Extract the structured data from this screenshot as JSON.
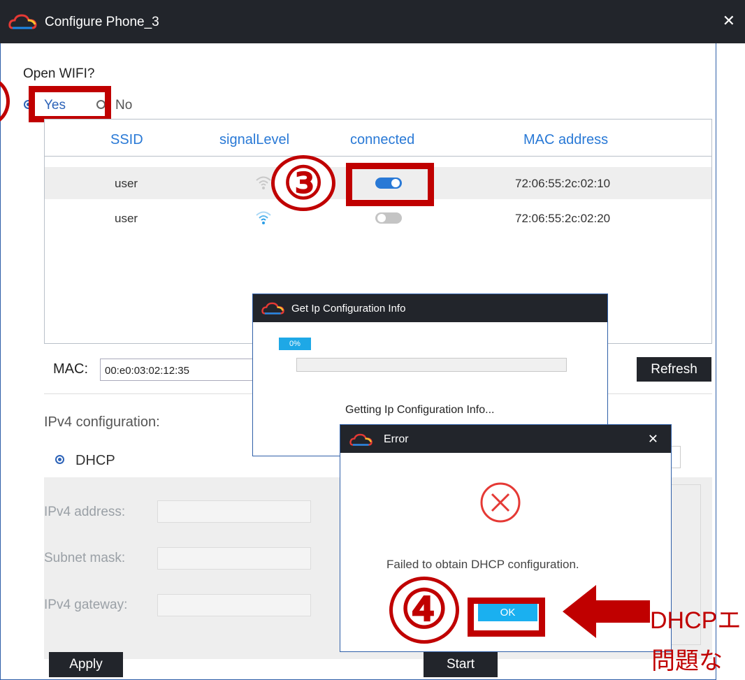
{
  "main_window": {
    "title": "Configure Phone_3",
    "close_glyph": "✕",
    "open_wifi_label": "Open WIFI?",
    "yes_label": "Yes",
    "no_label": "No",
    "columns": [
      "SSID",
      "signalLevel",
      "connected",
      "MAC address"
    ],
    "networks": [
      {
        "ssid": "user",
        "connected": true,
        "mac": "72:06:55:2c:02:10"
      },
      {
        "ssid": "user",
        "connected": false,
        "mac": "72:06:55:2c:02:20"
      }
    ],
    "mac_label": "MAC:",
    "mac_value": "00:e0:03:02:12:35",
    "refresh_label": "Refresh",
    "ipv4_config_label": "IPv4 configuration:",
    "dhcp_label": "DHCP",
    "ipv4_address_label": "IPv4 address:",
    "subnet_mask_label": "Subnet mask:",
    "ipv4_gateway_label": "IPv4 gateway:",
    "apply_label": "Apply",
    "start_label": "Start"
  },
  "progress_dialog": {
    "title": "Get Ip Configuration Info",
    "percent_label": "0%",
    "progress": 0,
    "status_text": "Getting Ip Configuration Info..."
  },
  "error_dialog": {
    "title": "Error",
    "close_glyph": "✕",
    "message": "Failed to obtain DHCP configuration.",
    "ok_label": "OK"
  },
  "annotations": {
    "step3": "③",
    "step4": "④",
    "note_line1": "DHCPエ",
    "note_line2": "問題な"
  },
  "colors": {
    "accent_blue": "#2979d6",
    "annotation_red": "#c00000",
    "titlebar": "#22252b",
    "ok_button": "#1ab0f0"
  },
  "icons": [
    "cloud-logo-icon",
    "close-icon",
    "wifi-signal-icon",
    "toggle-switch-icon",
    "error-x-circle-icon",
    "arrow-left-icon"
  ]
}
